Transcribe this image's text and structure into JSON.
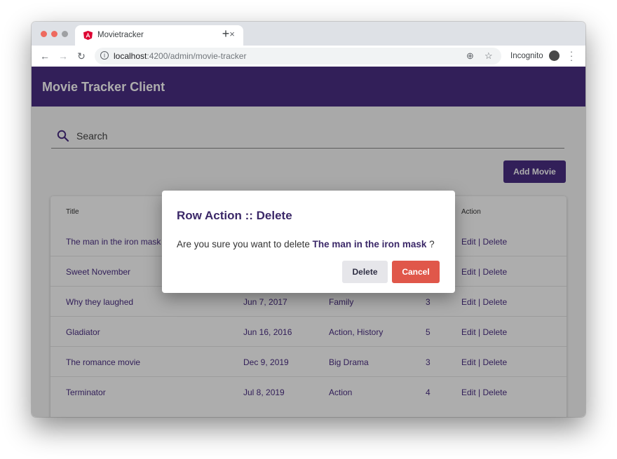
{
  "browser": {
    "tab_title": "Movietracker",
    "url_host": "localhost",
    "url_rest": ":4200/admin/movie-tracker",
    "incognito_label": "Incognito",
    "new_tab_symbol": "+",
    "close_symbol": "×"
  },
  "app": {
    "title": "Movie Tracker Client",
    "search_placeholder": "Search",
    "add_button": "Add Movie",
    "accent_color": "#4b2e83"
  },
  "table": {
    "headers": {
      "title": "Title",
      "action": "Action"
    },
    "rows": [
      {
        "title": "The man in the iron mask",
        "date": "",
        "genre": "",
        "rating": "",
        "edit": "Edit",
        "sep": " | ",
        "delete": "Delete"
      },
      {
        "title": "Sweet November",
        "date": "",
        "genre": "",
        "rating": "",
        "edit": "Edit",
        "sep": " | ",
        "delete": "Delete"
      },
      {
        "title": "Why they laughed",
        "date": "Jun 7, 2017",
        "genre": "Family",
        "rating": "3",
        "edit": "Edit",
        "sep": " | ",
        "delete": "Delete"
      },
      {
        "title": "Gladiator",
        "date": "Jun 16, 2016",
        "genre": "Action, History",
        "rating": "5",
        "edit": "Edit",
        "sep": " | ",
        "delete": "Delete"
      },
      {
        "title": "The romance movie",
        "date": "Dec 9, 2019",
        "genre": "Big Drama",
        "rating": "3",
        "edit": "Edit",
        "sep": " | ",
        "delete": "Delete"
      },
      {
        "title": "Terminator",
        "date": "Jul 8, 2019",
        "genre": "Action",
        "rating": "4",
        "edit": "Edit",
        "sep": " | ",
        "delete": "Delete"
      }
    ]
  },
  "dialog": {
    "title": "Row Action :: Delete",
    "body_prefix": "Are you sure you want to delete ",
    "body_bold": "The man in the iron mask",
    "body_suffix": " ?",
    "delete_button": "Delete",
    "cancel_button": "Cancel",
    "cancel_color": "#e0574a"
  }
}
